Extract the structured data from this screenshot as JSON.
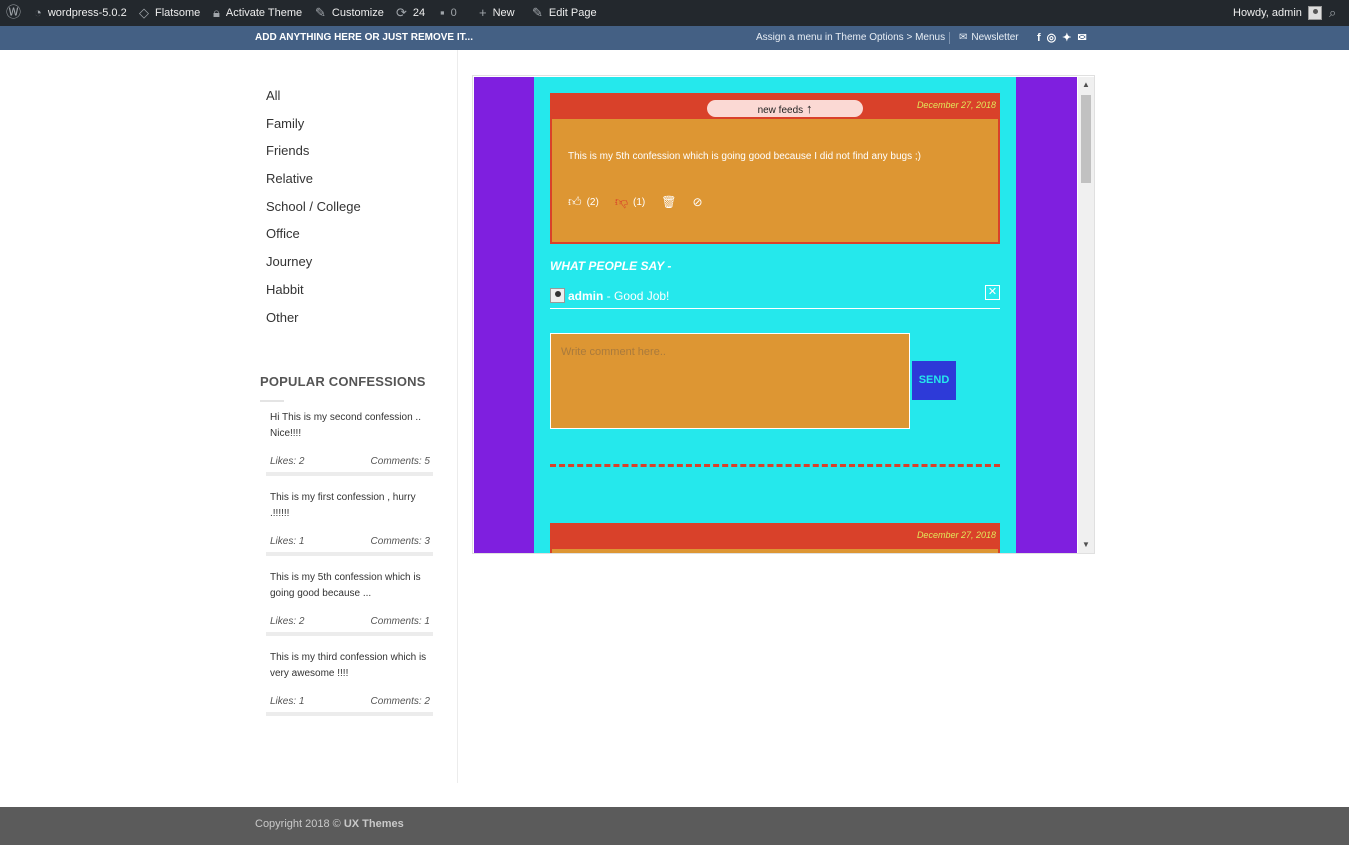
{
  "adminbar": {
    "site": "wordpress-5.0.2",
    "theme": "Flatsome",
    "activate": "Activate Theme",
    "customize": "Customize",
    "updates": "24",
    "comments": "0",
    "new": "New",
    "edit": "Edit Page",
    "howdy": "Howdy, admin"
  },
  "topbar": {
    "message": "ADD ANYTHING HERE OR JUST REMOVE IT...",
    "assign": "Assign a menu in Theme Options > Menus",
    "newsletter": "Newsletter",
    "social": {
      "facebook": "f",
      "instagram": "◎",
      "twitter": "✦",
      "email": "✉"
    }
  },
  "categories": [
    "All",
    "Family",
    "Friends",
    "Relative",
    "School / College",
    "Office",
    "Journey",
    "Habbit",
    "Other"
  ],
  "popular": {
    "title": "POPULAR CONFESSIONS",
    "items": [
      {
        "text": "Hi This is my second confession .. Nice!!!!",
        "likes": "Likes: 2",
        "comments": "Comments: 5"
      },
      {
        "text": "This is my first confession , hurry .!!!!!!",
        "likes": "Likes: 1",
        "comments": "Comments: 3"
      },
      {
        "text": "This is my 5th confession which is going good because ...",
        "likes": "Likes: 2",
        "comments": "Comments: 1"
      },
      {
        "text": "This is my third confession which is very awesome !!!!",
        "likes": "Likes: 1",
        "comments": "Comments: 2"
      }
    ]
  },
  "feed": {
    "new_feeds": "new feeds",
    "post1": {
      "date": "December 27, 2018",
      "body": "This is my 5th confession which is going good because I did not find any bugs ;)",
      "likes": "(2)",
      "dislikes": "(1)"
    },
    "what_people_say": "WHAT PEOPLE SAY -",
    "comment": {
      "author": "admin",
      "text": " - Good Job!"
    },
    "comment_placeholder": "Write comment here..",
    "send": "SEND",
    "post2": {
      "date": "December 27, 2018"
    }
  },
  "footer": {
    "copyright": "Copyright 2018 ©",
    "brand": "UX Themes"
  },
  "colors": {
    "adminbar": "#23282d",
    "topbar": "#446084",
    "purple": "#7f1fdf",
    "cyan": "#25e8ec",
    "card": "#dd9633",
    "card_header": "#d9412a",
    "send": "#2d3ad8"
  }
}
